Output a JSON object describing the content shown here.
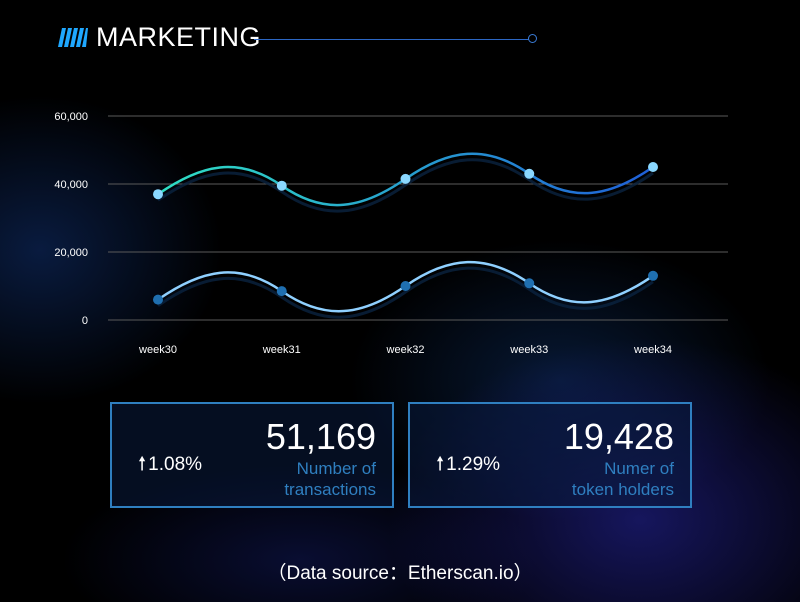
{
  "header": {
    "title": "MARKETING"
  },
  "chart_data": {
    "type": "line",
    "categories": [
      "week30",
      "week31",
      "week32",
      "week33",
      "week34"
    ],
    "series": [
      {
        "values": [
          37000,
          39500,
          41500,
          43000,
          45000
        ],
        "color_start": "#2fe0c4",
        "color_end": "#1f5fd8",
        "marker": "#8ad8ff"
      },
      {
        "values": [
          6000,
          8500,
          10000,
          10800,
          13000
        ],
        "color_start": "#8fd0ff",
        "color_end": "#8fd0ff",
        "marker": "#1f6fb0"
      }
    ],
    "y_ticks": [
      "0",
      "20,000",
      "40,000",
      "60,000"
    ],
    "y_tick_values": [
      0,
      20000,
      40000,
      60000
    ],
    "ylim": [
      0,
      60000
    ],
    "grid": true
  },
  "cards": [
    {
      "change": "1.08%",
      "value": "51,169",
      "label_line1": "Number of",
      "label_line2": "transactions"
    },
    {
      "change": "1.29%",
      "value": "19,428",
      "label_line1": "Numer of",
      "label_line2": "token holders"
    }
  ],
  "footer": {
    "source": "（Data source：Etherscan.io）"
  },
  "colors": {
    "accent": "#2f7fc0",
    "title_icon": "#1fa8ff"
  }
}
